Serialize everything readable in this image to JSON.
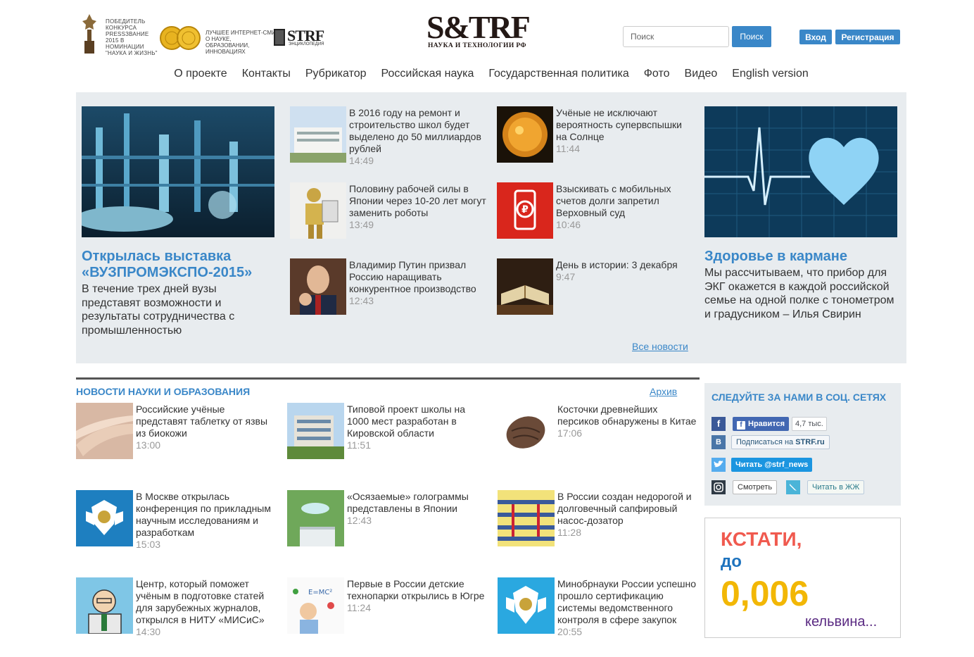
{
  "header": {
    "award_text": "Победитель конкурса PRESSЗВАНИЕ 2015 в номинации \"Наука и жизнь\"",
    "medal_text": "Лучшее интернет-СМИ о науке, образовании, инновациях",
    "encyc_logo": "STRF",
    "encyc_sub": "энциклопедия",
    "logo_main": "S&TRF",
    "logo_sub": "НАУКА И ТЕХНОЛОГИИ РФ",
    "search_placeholder": "Поиск",
    "search_button": "Поиск",
    "login_button": "Вход",
    "register_button": "Регистрация"
  },
  "nav": [
    "О проекте",
    "Контакты",
    "Рубрикатор",
    "Российская наука",
    "Государственная политика",
    "Фото",
    "Видео",
    "English version"
  ],
  "featured_left": {
    "title": "Открылась выставка «ВУЗПРОМЭКСПО-2015»",
    "lead": "В течение трех дней вузы представят возможности и результаты сотрудничества с промышленностью"
  },
  "featured_right": {
    "title": "Здоровье в кармане",
    "lead": "Мы рассчитываем, что прибор для ЭКГ окажется в каждой российской семье на одной полке с тонометром и градусником – Илья Свирин"
  },
  "top_news": [
    {
      "title": "В 2016 году на ремонт и строительство школ будет выделено до 50 миллиардов рублей",
      "time": "14:49"
    },
    {
      "title": "Половину рабочей силы в Японии через 10-20 лет могут заменить роботы",
      "time": "13:49"
    },
    {
      "title": "Владимир Путин призвал Россию наращивать конкурентное производство",
      "time": "12:43"
    },
    {
      "title": "Учёные не исключают вероятность супервспышки на Солнце",
      "time": "11:44"
    },
    {
      "title": "Взыскивать с мобильных счетов долги запретил Верховный суд",
      "time": "10:46"
    },
    {
      "title": "День в истории: 3 декабря",
      "time": "9:47"
    }
  ],
  "all_news_link": "Все новости",
  "science_section": {
    "title": "Новости науки и образования",
    "archive_link": "Архив",
    "items": [
      {
        "title": "Российские учёные представят таблетку от язвы из биокожи",
        "time": "13:00"
      },
      {
        "title": "Типовой проект школы на 1000 мест разработан в Кировской области",
        "time": "11:51"
      },
      {
        "title": "Косточки древнейших персиков обнаружены в Китае",
        "time": "17:06"
      },
      {
        "title": "В Москве открылась конференция по прикладным научным исследованиям и разработкам",
        "time": "15:03"
      },
      {
        "title": "«Осязаемые» голограммы представлены в Японии",
        "time": "12:43"
      },
      {
        "title": "В России создан недорогой и долговечный сапфировый насос-дозатор",
        "time": "11:28"
      },
      {
        "title": "Центр, который поможет учёным в подготовке статей для зарубежных журналов, открылся в НИТУ «МИСиС»",
        "time": "14:30"
      },
      {
        "title": "Первые в России детские технопарки открылись в Югре",
        "time": "11:24"
      },
      {
        "title": "Минобрнауки России успешно прошло сертификацию системы ведомственного контроля в сфере закупок",
        "time": "20:55"
      }
    ]
  },
  "social": {
    "title": "Следуйте за нами в соц. сетях",
    "fb_like": "Нравится",
    "fb_count": "4,7 тыс.",
    "vk_subscribe": "Подписаться на ",
    "vk_site": "STRF.ru",
    "tw_follow": "Читать @strf_news",
    "ig_watch": "Смотреть",
    "lj_read": "Читать в ЖЖ"
  },
  "kstati": {
    "line1": "КСТАТИ,",
    "line2": "до",
    "value": "0,006",
    "unit": "кельвина..."
  },
  "colors": {
    "accent": "#3a87c8",
    "panel_bg": "#e8ecef",
    "time": "#999999"
  }
}
